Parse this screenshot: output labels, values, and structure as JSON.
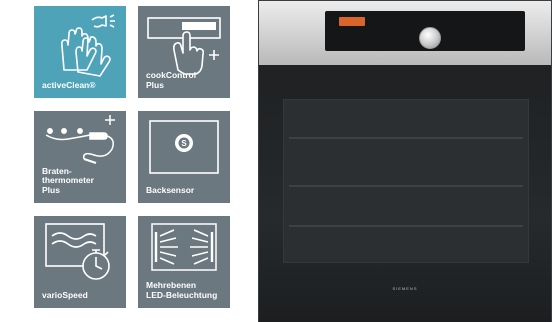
{
  "features": [
    {
      "id": "activeclean",
      "label": [
        "activeClean®"
      ],
      "icon": "gloves-spray-icon"
    },
    {
      "id": "cookcontrol",
      "label": [
        "cookControl",
        "Plus"
      ],
      "icon": "touch-display-plus-icon"
    },
    {
      "id": "bratenthermometer",
      "label": [
        "Braten-",
        "thermometer",
        "Plus"
      ],
      "icon": "meat-probe-plus-icon"
    },
    {
      "id": "backsensor",
      "label": [
        "Backsensor"
      ],
      "icon": "bake-sensor-icon"
    },
    {
      "id": "variospeed",
      "label": [
        "varioSpeed"
      ],
      "icon": "waves-stopwatch-icon"
    },
    {
      "id": "mehrebenen",
      "label": [
        "Mehrebenen",
        "LED-Beleuchtung"
      ],
      "icon": "multi-level-led-icon"
    }
  ],
  "oven": {
    "brand": "SIEMENS",
    "display_color": "#d9652a"
  },
  "colors": {
    "tile_gray": "#6b7880",
    "tile_accent": "#4fa3b8",
    "oven_body": "#1f2123"
  }
}
